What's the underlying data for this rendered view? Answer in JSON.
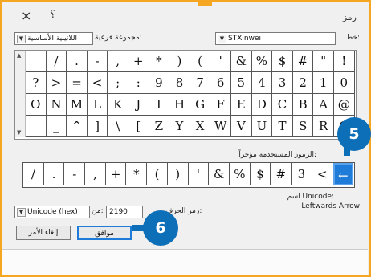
{
  "titlebar": {
    "title": "رمز",
    "close_icon": "×",
    "help_icon": "؟"
  },
  "font": {
    "label": "خط:",
    "value": "STXinwei"
  },
  "subset": {
    "label": "مجموعة فرعية:",
    "value": "اللاتينية الأساسية"
  },
  "grid": {
    "rows": [
      [
        "!",
        "\"",
        "#",
        "$",
        "%",
        "&",
        "'",
        "(",
        ")",
        "*",
        "+",
        ",",
        "-",
        ".",
        "/",
        ""
      ],
      [
        "0",
        "1",
        "2",
        "3",
        "4",
        "5",
        "6",
        "7",
        "8",
        "9",
        ":",
        ";",
        "<",
        "=",
        ">",
        "?"
      ],
      [
        "@",
        "A",
        "B",
        "C",
        "D",
        "E",
        "F",
        "G",
        "H",
        "I",
        "J",
        "K",
        "L",
        "M",
        "N",
        "O"
      ],
      [
        "Q",
        "R",
        "S",
        "T",
        "U",
        "V",
        "W",
        "X",
        "Y",
        "Z",
        "[",
        "\\",
        "]",
        "^",
        "_",
        ""
      ]
    ]
  },
  "recent": {
    "label": "الرموز المستخدمة مؤخراً:",
    "items": [
      "←",
      "<",
      "3",
      "#",
      "$",
      "%",
      "&",
      "'",
      ")",
      "(",
      "*",
      "+",
      ",",
      "-",
      ".",
      "/"
    ]
  },
  "unicode_name": {
    "label": "اسم Unicode:",
    "value": "Leftwards Arrow"
  },
  "char_code": {
    "label": "رمز الحرف:",
    "value": "2190"
  },
  "from": {
    "label": "من:",
    "value": "Unicode (hex)"
  },
  "buttons": {
    "ok": "موافق",
    "cancel": "إلغاء الأمر"
  },
  "callouts": {
    "five": "5",
    "six": "6"
  },
  "colors": {
    "accent": "#1e7bd8",
    "frame": "#f5a623",
    "badge": "#0d6fb8"
  }
}
